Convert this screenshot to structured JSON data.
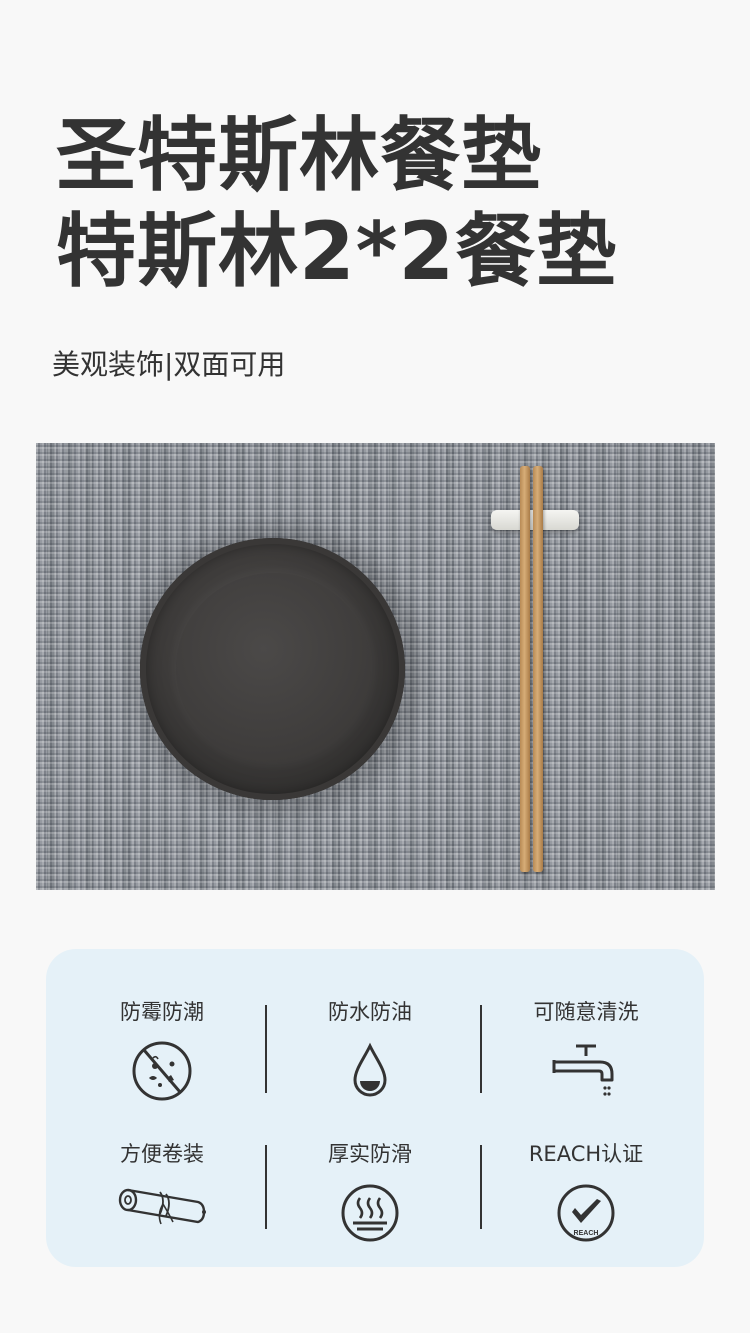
{
  "title_line1": "圣特斯林餐垫",
  "title_line2": "特斯林2*2餐垫",
  "subtitle": "美观装饰|双面可用",
  "features": [
    {
      "label": "防霉防潮",
      "icon": "anti-mold-icon"
    },
    {
      "label": "防水防油",
      "icon": "water-drop-icon"
    },
    {
      "label": "可随意清洗",
      "icon": "faucet-icon"
    },
    {
      "label": "方便卷装",
      "icon": "rolled-mat-icon"
    },
    {
      "label": "厚实防滑",
      "icon": "anti-slip-icon"
    },
    {
      "label": "REACH认证",
      "icon": "reach-check-icon"
    }
  ],
  "reach_badge": "REACH",
  "colors": {
    "panel": "#e5f1f8",
    "text": "#333333"
  }
}
